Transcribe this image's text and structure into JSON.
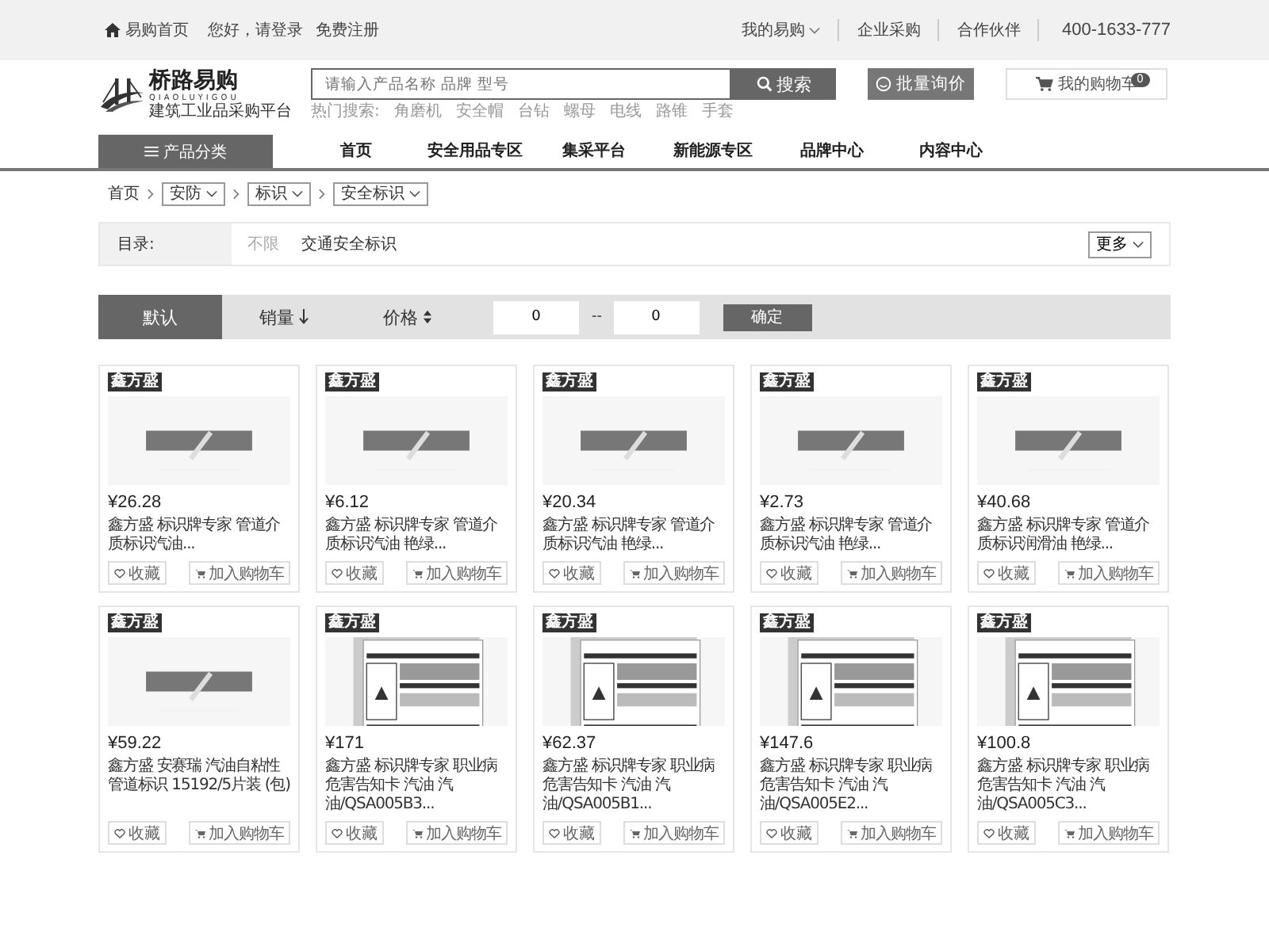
{
  "top_bar": {
    "home": "易购首页",
    "login": "您好，请登录",
    "register": "免费注册",
    "links": [
      {
        "label": "我的易购",
        "dropdown": true
      },
      {
        "label": "企业采购",
        "dropdown": false
      },
      {
        "label": "合作伙伴",
        "dropdown": false
      }
    ],
    "phone": "400-1633-777"
  },
  "header": {
    "logo": {
      "name": "桥路易购",
      "pinyin": "QIAOLUYIGOU",
      "slogan": "建筑工业品采购平台"
    },
    "search": {
      "placeholder": "请输入产品名称 品牌 型号",
      "button": "搜索"
    },
    "hot_label": "热门搜索:",
    "hot_terms": [
      "角磨机",
      "安全帽",
      "台钻",
      "螺母",
      "电线",
      "路锥",
      "手套"
    ],
    "inquiry": "批量询价",
    "cart": {
      "label": "我的购物车",
      "count": "0"
    }
  },
  "nav": {
    "category": "产品分类",
    "items": [
      "首页",
      "安全用品专区",
      "集采平台",
      "新能源专区",
      "品牌中心",
      "内容中心"
    ]
  },
  "breadcrumb": {
    "home": "首页",
    "levels": [
      "安防",
      "标识",
      "安全标识"
    ]
  },
  "filter": {
    "label": "目录:",
    "options": [
      {
        "label": "不限",
        "selected": true
      },
      {
        "label": "交通安全标识",
        "selected": false
      }
    ],
    "more": "更多"
  },
  "sort": {
    "options": [
      {
        "label": "默认",
        "selected": true,
        "kind": "plain"
      },
      {
        "label": "销量",
        "selected": false,
        "kind": "down"
      },
      {
        "label": "价格",
        "selected": false,
        "kind": "updown"
      }
    ],
    "min": "0",
    "separator": "--",
    "max": "0",
    "confirm": "确定"
  },
  "products": [
    {
      "badge": "鑫方盛",
      "price": "¥26.28",
      "title": "鑫方盛 标识牌专家 管道介质标识汽油...",
      "favorite": "收藏",
      "add_to_cart": "加入购物车"
    },
    {
      "badge": "鑫方盛",
      "price": "¥6.12",
      "title": "鑫方盛 标识牌专家 管道介质标识汽油 艳绿...",
      "favorite": "收藏",
      "add_to_cart": "加入购物车"
    },
    {
      "badge": "鑫方盛",
      "price": "¥20.34",
      "title": "鑫方盛 标识牌专家 管道介质标识汽油 艳绿...",
      "favorite": "收藏",
      "add_to_cart": "加入购物车"
    },
    {
      "badge": "鑫方盛",
      "price": "¥2.73",
      "title": "鑫方盛 标识牌专家 管道介质标识汽油 艳绿...",
      "favorite": "收藏",
      "add_to_cart": "加入购物车"
    },
    {
      "badge": "鑫方盛",
      "price": "¥40.68",
      "title": "鑫方盛 标识牌专家 管道介质标识润滑油 艳绿...",
      "favorite": "收藏",
      "add_to_cart": "加入购物车"
    },
    {
      "badge": "鑫方盛",
      "price": "¥59.22",
      "title": "鑫方盛 安赛瑞 汽油自粘性管道标识 15192/5片装 (包)",
      "favorite": "收藏",
      "add_to_cart": "加入购物车"
    },
    {
      "badge": "鑫方盛",
      "price": "¥171",
      "title": "鑫方盛 标识牌专家 职业病危害告知卡 汽油 汽油/QSA005B3...",
      "favorite": "收藏",
      "add_to_cart": "加入购物车"
    },
    {
      "badge": "鑫方盛",
      "price": "¥62.37",
      "title": "鑫方盛 标识牌专家 职业病危害告知卡 汽油 汽油/QSA005B1...",
      "favorite": "收藏",
      "add_to_cart": "加入购物车"
    },
    {
      "badge": "鑫方盛",
      "price": "¥147.6",
      "title": "鑫方盛 标识牌专家 职业病危害告知卡 汽油 汽油/QSA005E2...",
      "favorite": "收藏",
      "add_to_cart": "加入购物车"
    },
    {
      "badge": "鑫方盛",
      "price": "¥100.8",
      "title": "鑫方盛 标识牌专家 职业病危害告知卡 汽油 汽油/QSA005C3...",
      "favorite": "收藏",
      "add_to_cart": "加入购物车"
    }
  ]
}
